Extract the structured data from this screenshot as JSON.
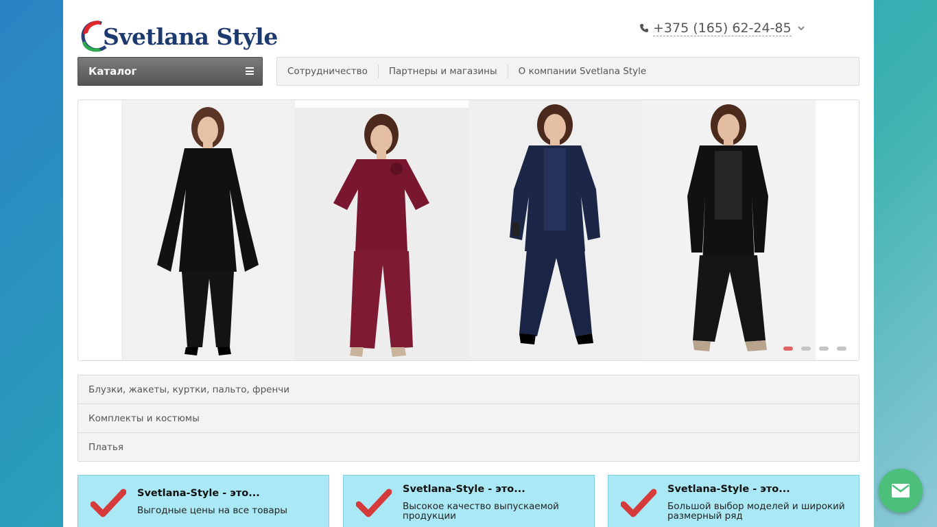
{
  "header": {
    "logo_text": "Svetlana Style",
    "phone": "+375 (165) 62-24-85"
  },
  "catalog_button": {
    "label": "Каталог"
  },
  "topnav": {
    "items": [
      "Сотрудничество",
      "Партнеры и магазины",
      "О компании Svetlana Style"
    ]
  },
  "slider": {
    "slides_count": 4,
    "active_slide": 1,
    "outfits": [
      {
        "top": "black tunic with lace sleeves",
        "bottom": "black trousers",
        "color": "#111111"
      },
      {
        "top": "burgundy blouse",
        "bottom": "burgundy wide trousers",
        "color": "#7a1730"
      },
      {
        "top": "navy jacket with sequin top",
        "bottom": "navy trousers",
        "color": "#1c2748"
      },
      {
        "top": "black jacket with sequin top",
        "bottom": "black wide trousers",
        "color": "#151515"
      }
    ]
  },
  "categories": [
    "Блузки, жакеты, куртки, пальто, френчи",
    "Комплекты и костюмы",
    "Платья"
  ],
  "features": [
    {
      "title": "Svetlana-Style - это...",
      "text": "Выгодные цены на все товары"
    },
    {
      "title": "Svetlana-Style - это...",
      "text": "Высокое качество выпускаемой продукции"
    },
    {
      "title": "Svetlana-Style - это...",
      "text": "Большой выбор моделей и широкий размерный ряд"
    }
  ],
  "colors": {
    "accent_red": "#d63b3b",
    "feature_bg": "#a9e8f4",
    "fab_green": "#4cc07a",
    "logo_blue": "#1d3a6e"
  },
  "icons": {
    "phone": "phone-icon",
    "dropdown": "chevron-down-icon",
    "menu": "hamburger-icon",
    "check": "checkmark-icon",
    "mail": "mail-icon"
  }
}
